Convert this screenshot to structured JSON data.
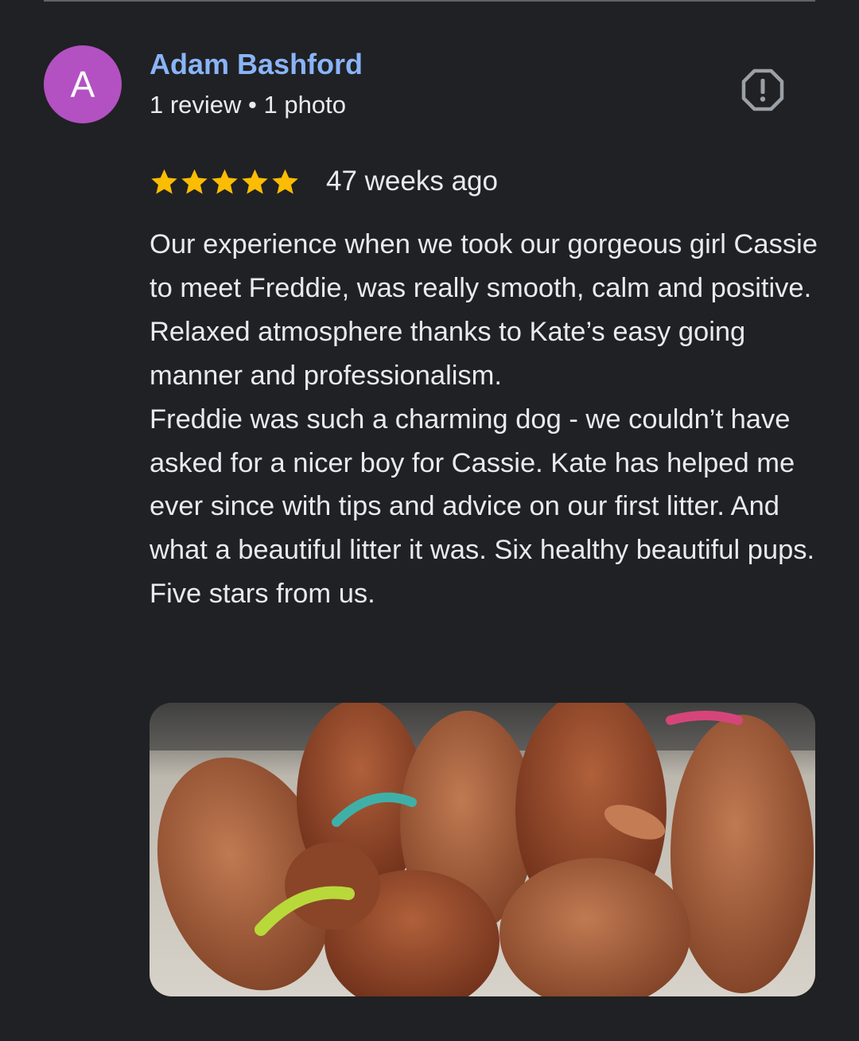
{
  "reviewer": {
    "avatar_letter": "A",
    "avatar_color": "#b351c3",
    "name": "Adam Bashford",
    "meta": "1 review • 1 photo"
  },
  "report_icon": "report-flag-icon",
  "rating": {
    "stars": 5,
    "max_stars": 5,
    "star_color": "#fbbc04",
    "time_ago": "47 weeks ago"
  },
  "review": {
    "paragraph_1": "Our experience when we took our gorgeous girl Cassie to meet Freddie, was really smooth, calm and positive. Relaxed atmosphere thanks to Kate’s easy going manner and professionalism.",
    "paragraph_2": "Freddie was such a charming dog - we couldn’t have asked for a nicer boy for Cassie. Kate has helped me ever since with tips and advice on our first litter. And what a beautiful litter it was. Six healthy beautiful pups. Five stars from us."
  },
  "colors": {
    "background": "#202124",
    "name_link": "#8ab4f8",
    "text": "#e8eaed"
  }
}
